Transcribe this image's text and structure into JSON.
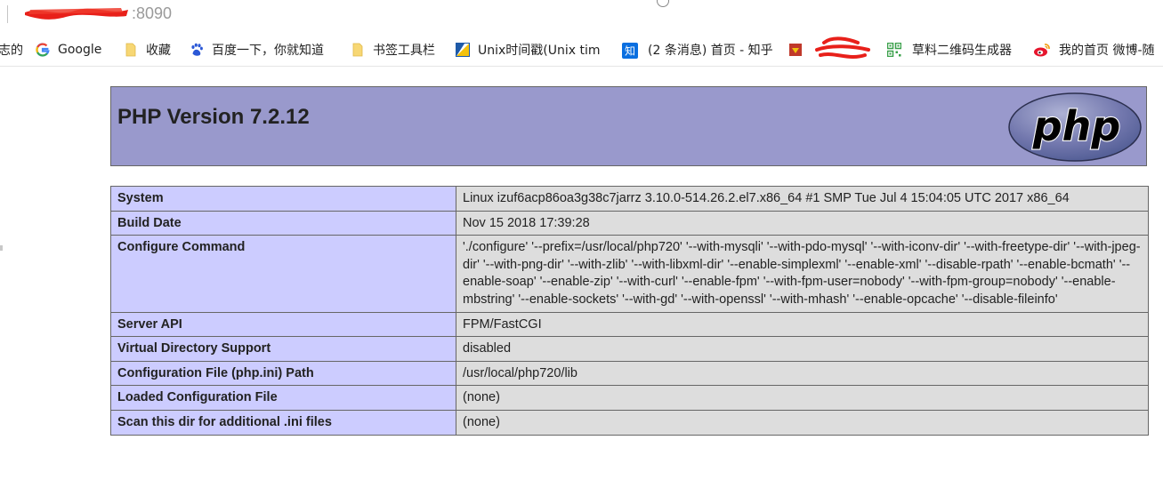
{
  "browser": {
    "url_visible": ":8090",
    "bookmarks": [
      {
        "label": "志的",
        "icon": "partial-icon"
      },
      {
        "label": "Google",
        "icon": "google-icon"
      },
      {
        "label": "收藏",
        "icon": "folder-icon"
      },
      {
        "label": "百度一下，你就知道",
        "icon": "baidu-paw-icon"
      },
      {
        "label": "书签工具栏",
        "icon": "folder-icon"
      },
      {
        "label": "Unix时间戳(Unix tim",
        "icon": "unix-timestamp-icon"
      },
      {
        "label": "(2 条消息) 首页 - 知乎",
        "icon": "zhihu-icon"
      },
      {
        "label": "",
        "icon": "bookmark-red-icon"
      },
      {
        "label": "草料二维码生成器",
        "icon": "qrcode-icon"
      },
      {
        "label": "我的首页 微博-随",
        "icon": "weibo-icon"
      }
    ]
  },
  "php": {
    "title": "PHP Version 7.2.12",
    "logo_text": "php",
    "rows": [
      {
        "key": "System",
        "value": "Linux izuf6acp86oa3g38c7jarrz 3.10.0-514.26.2.el7.x86_64 #1 SMP Tue Jul 4 15:04:05 UTC 2017 x86_64"
      },
      {
        "key": "Build Date",
        "value": "Nov 15 2018 17:39:28"
      },
      {
        "key": "Configure Command",
        "value": "'./configure' '--prefix=/usr/local/php720' '--with-mysqli' '--with-pdo-mysql' '--with-iconv-dir' '--with-freetype-dir' '--with-jpeg-dir' '--with-png-dir' '--with-zlib' '--with-libxml-dir' '--enable-simplexml' '--enable-xml' '--disable-rpath' '--enable-bcmath' '--enable-soap' '--enable-zip' '--with-curl' '--enable-fpm' '--with-fpm-user=nobody' '--with-fpm-group=nobody' '--enable-mbstring' '--enable-sockets' '--with-gd' '--with-openssl' '--with-mhash' '--enable-opcache' '--disable-fileinfo'"
      },
      {
        "key": "Server API",
        "value": "FPM/FastCGI"
      },
      {
        "key": "Virtual Directory Support",
        "value": "disabled"
      },
      {
        "key": "Configuration File (php.ini) Path",
        "value": "/usr/local/php720/lib"
      },
      {
        "key": "Loaded Configuration File",
        "value": "(none)"
      },
      {
        "key": "Scan this dir for additional .ini files",
        "value": "(none)"
      }
    ]
  },
  "colors": {
    "header_bg": "#9999cc",
    "key_bg": "#ccccff",
    "value_bg": "#dddddd",
    "border": "#666666",
    "redaction": "#e8201a"
  }
}
